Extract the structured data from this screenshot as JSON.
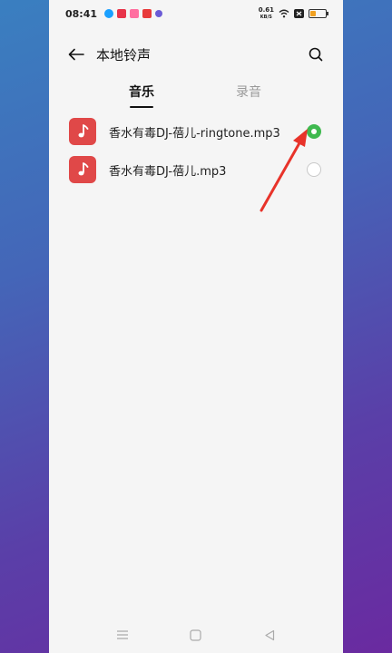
{
  "status_bar": {
    "time": "08:41",
    "net_speed_value": "0.61",
    "net_speed_unit": "KB/S",
    "notification_colors": [
      "#1aa0ff",
      "#e8344a",
      "#ff6fa0",
      "#e83a3a",
      "#6b5bd6"
    ],
    "battery_color": "#f0a020"
  },
  "header": {
    "title": "本地铃声",
    "back_icon": "arrow-left-icon",
    "search_icon": "search-icon"
  },
  "tabs": [
    {
      "label": "音乐",
      "active": true
    },
    {
      "label": "录音",
      "active": false
    }
  ],
  "files": [
    {
      "name": "香水有毒DJ-蓓儿-ringtone.mp3",
      "selected": true,
      "icon": "music-note-icon"
    },
    {
      "name": "香水有毒DJ-蓓儿.mp3",
      "selected": false,
      "icon": "music-note-icon"
    }
  ],
  "colors": {
    "accent_green": "#3fb94f",
    "file_icon_red": "#e04848",
    "annotation_red": "#e8332a"
  },
  "nav_bar": {
    "icons": [
      "menu-icon",
      "home-square-icon",
      "back-triangle-icon"
    ]
  }
}
